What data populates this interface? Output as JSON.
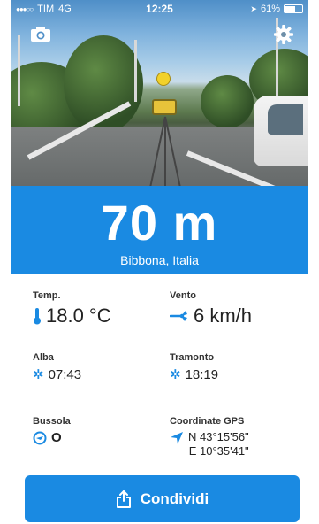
{
  "status_bar": {
    "carrier": "TIM",
    "network": "4G",
    "time": "12:25",
    "battery": "61%",
    "battery_level": 0.61
  },
  "photo": {
    "camera_icon": "camera-icon",
    "settings_icon": "gear-icon"
  },
  "altitude": {
    "value": "70 m",
    "location": "Bibbona, Italia"
  },
  "info": {
    "temp": {
      "label": "Temp.",
      "value": "18.0 °C",
      "icon": "thermometer-icon"
    },
    "wind": {
      "label": "Vento",
      "value": "6 km/h",
      "icon": "wind-icon"
    },
    "sunrise": {
      "label": "Alba",
      "value": "07:43",
      "icon": "sunrise-icon"
    },
    "sunset": {
      "label": "Tramonto",
      "value": "18:19",
      "icon": "sunset-icon"
    },
    "compass": {
      "label": "Bussola",
      "value": "O",
      "icon": "compass-icon"
    },
    "gps": {
      "label": "Coordinate GPS",
      "lat": "N 43°15'56\"",
      "lon": "E 10°35'41\"",
      "icon": "location-arrow-icon"
    }
  },
  "share": {
    "label": "Condividi",
    "icon": "share-icon"
  },
  "colors": {
    "accent": "#1a8ae2"
  }
}
